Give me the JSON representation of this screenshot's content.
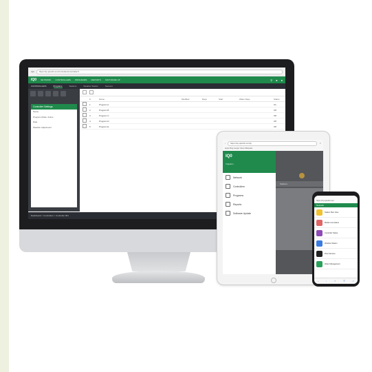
{
  "desktop": {
    "browser": {
      "url": "https://iq.opto22.com/controllers/controller/1",
      "tab": "IQ0"
    },
    "header": {
      "logo": "IQ0",
      "nav": [
        "NETWORK",
        "CONTROLLERS",
        "PROGRAMS",
        "REPORTS",
        "SOFTWARE UP"
      ]
    },
    "subheader": {
      "title": "CONTROLLERS",
      "tabs": [
        "Programs",
        "Stations",
        "Weather Station",
        "Sensors"
      ]
    },
    "sidebar": {
      "panel_title": "Controller Settings",
      "rows": [
        "Name",
        "Program Mode: Active",
        "Date",
        "Weather Adjustment"
      ]
    },
    "table": {
      "headers": [
        "",
        "#",
        "Name",
        "Modified",
        "Days",
        "Start",
        "Water Days",
        "Status"
      ],
      "rows": [
        {
          "num": "1",
          "name": "Program A",
          "status": "On"
        },
        {
          "num": "2",
          "name": "Program B",
          "status": "Off"
        },
        {
          "num": "3",
          "name": "Program C",
          "status": "Off"
        },
        {
          "num": "4",
          "name": "Program D",
          "status": "Off"
        },
        {
          "num": "5",
          "name": "Program E",
          "status": "Off"
        }
      ]
    },
    "footer": "Dashboard > Controllers > Controller 001"
  },
  "tablet": {
    "url_label": "https://iq.opto22.com/ip",
    "bookmarks": "Apple  Bing  Google  Yahoo  Wikipedia",
    "brand": "IQ0",
    "brand_sub": "Irrigation",
    "menu": [
      "Network",
      "Controllers",
      "Programs",
      "Reports",
      "Software Update"
    ],
    "right_bar": "Stations"
  },
  "phone": {
    "url": "https://iq.opto22.com",
    "bar": "Network",
    "items": [
      {
        "title": "Station Plan View",
        "color": "#f1c232"
      },
      {
        "title": "Mobile Controllers",
        "color": "#e06666"
      },
      {
        "title": "Controller Status",
        "color": "#8e4bb5"
      },
      {
        "title": "Weather Station",
        "color": "#3b7be0"
      },
      {
        "title": "Flow Sensors",
        "color": "#222222"
      },
      {
        "title": "Water Management",
        "color": "#2aa15a"
      }
    ]
  },
  "colors": {
    "brand_green": "#1f8a4c",
    "dark_bar": "#2a2d33"
  }
}
